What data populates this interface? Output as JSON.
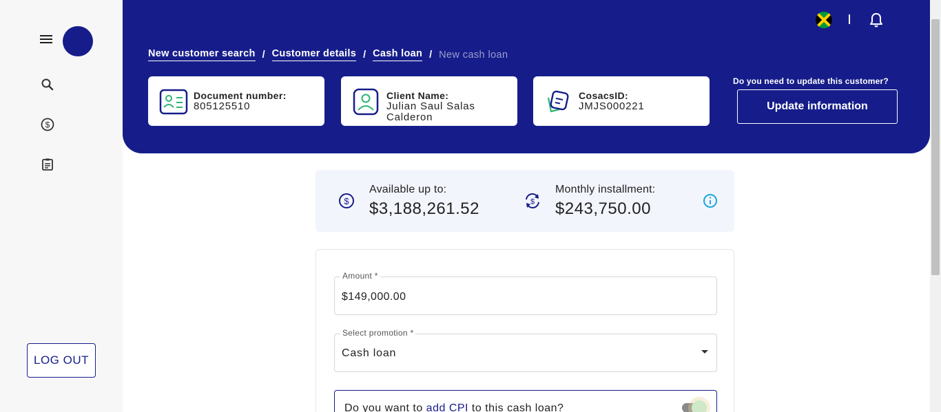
{
  "sidebar": {
    "menu_icon": "hamburger-icon",
    "nav_icons": [
      "search-icon",
      "dollar-circle-icon",
      "clipboard-icon"
    ],
    "logout_label": "LOG OUT"
  },
  "header": {
    "flag_icon": "jamaica-flag-icon",
    "divider_text": "I",
    "bell_icon": "bell-icon",
    "breadcrumb": {
      "item1": "New customer search",
      "item2": "Customer details",
      "item3": "Cash loan",
      "current": "New cash loan",
      "separator": "/"
    },
    "cards": {
      "document": {
        "label": "Document number:",
        "value": "805125510",
        "icon": "id-card-icon"
      },
      "client": {
        "label": "Client Name:",
        "value": "Julian Saul Salas Calderon",
        "icon": "user-icon"
      },
      "cosacs": {
        "label": "CosacsID:",
        "value": "JMJS000221",
        "icon": "sticker-icon"
      }
    },
    "update_question": "Do you need to update this customer?",
    "update_button": "Update information"
  },
  "summary": {
    "available_label": "Available up to:",
    "available_value": "$3,188,261.52",
    "monthly_label": "Monthly installment:",
    "monthly_value": "$243,750.00"
  },
  "form": {
    "amount_label": "Amount *",
    "amount_value": "$149,000.00",
    "promotion_label": "Select promotion *",
    "promotion_value": "Cash loan",
    "cpi_prefix": "Do you want to ",
    "cpi_highlight": "add CPI",
    "cpi_suffix": " to this cash loan?"
  },
  "colors": {
    "brand": "#161d8a",
    "accent_info": "#1aa7d8",
    "card_icon_green": "#2bb673"
  }
}
